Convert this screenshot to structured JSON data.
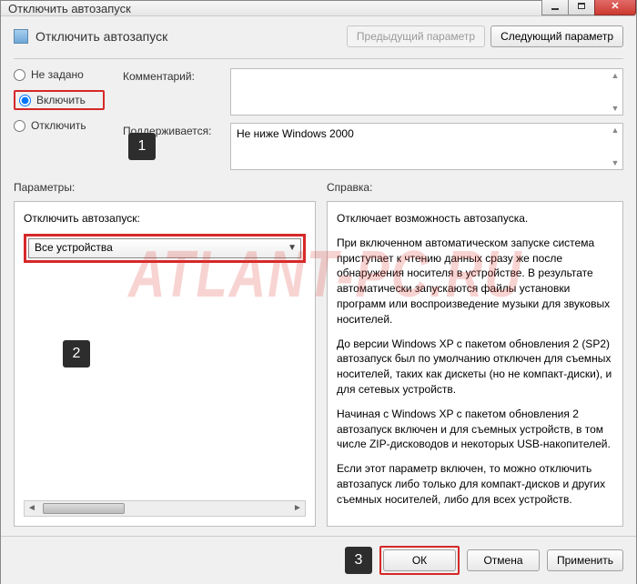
{
  "window": {
    "title": "Отключить автозапуск"
  },
  "header": {
    "title": "Отключить автозапуск",
    "prev": "Предыдущий параметр",
    "next": "Следующий параметр"
  },
  "radios": {
    "not_configured": "Не задано",
    "enabled": "Включить",
    "disabled": "Отключить",
    "selected": "enabled"
  },
  "meta": {
    "comment_label": "Комментарий:",
    "comment_value": "",
    "supported_label": "Поддерживается:",
    "supported_value": "Не ниже Windows 2000"
  },
  "params": {
    "section_label": "Параметры:",
    "field_label": "Отключить автозапуск:",
    "selected_option": "Все устройства"
  },
  "help": {
    "section_label": "Справка:",
    "p1": "Отключает возможность автозапуска.",
    "p2": "При включенном автоматическом запуске система приступает к чтению данных сразу же после обнаружения носителя в устройстве. В результате автоматически запускаются файлы установки программ или воспроизведение музыки для звуковых носителей.",
    "p3": "До версии Windows XP с пакетом обновления 2 (SP2) автозапуск был по умолчанию отключен для съемных носителей, таких как дискеты (но не компакт-диски), и для сетевых устройств.",
    "p4": "Начиная с Windows XP с пакетом обновления 2 автозапуск включен и для съемных устройств, в том числе ZIP-дисководов и некоторых USB-накопителей.",
    "p5": "Если этот параметр включен, то можно отключить автозапуск либо только для компакт-дисков и других съемных носителей, либо для всех устройств."
  },
  "footer": {
    "ok": "ОК",
    "cancel": "Отмена",
    "apply": "Применить"
  },
  "callouts": {
    "c1": "1",
    "c2": "2",
    "c3": "3"
  },
  "watermark": "ATLANT-PC.RU"
}
